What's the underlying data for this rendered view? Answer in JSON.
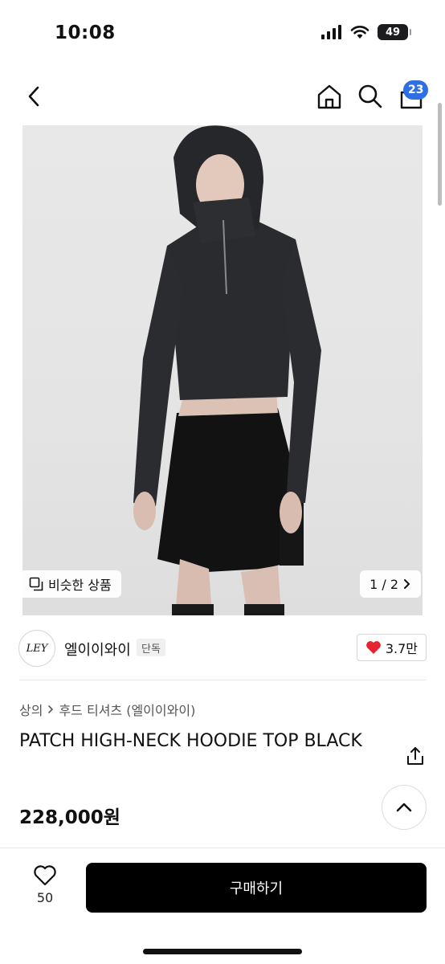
{
  "status_bar": {
    "time": "10:08",
    "battery": "49"
  },
  "nav": {
    "cart_count": "23"
  },
  "gallery": {
    "similar_label": "비슷한 상품",
    "page_indicator": "1 / 2"
  },
  "brand": {
    "logo_text": "LEY",
    "name": "엘이이와이",
    "tag": "단독",
    "likes": "3.7만",
    "like_color": "#e52431"
  },
  "product": {
    "breadcrumb": [
      "상의",
      "후드 티셔츠 (엘이이와이)"
    ],
    "title": "PATCH HIGH-NECK HOODIE TOP BLACK",
    "price": "228,000원"
  },
  "bottom_bar": {
    "wish_count": "50",
    "buy_label": "구매하기"
  }
}
